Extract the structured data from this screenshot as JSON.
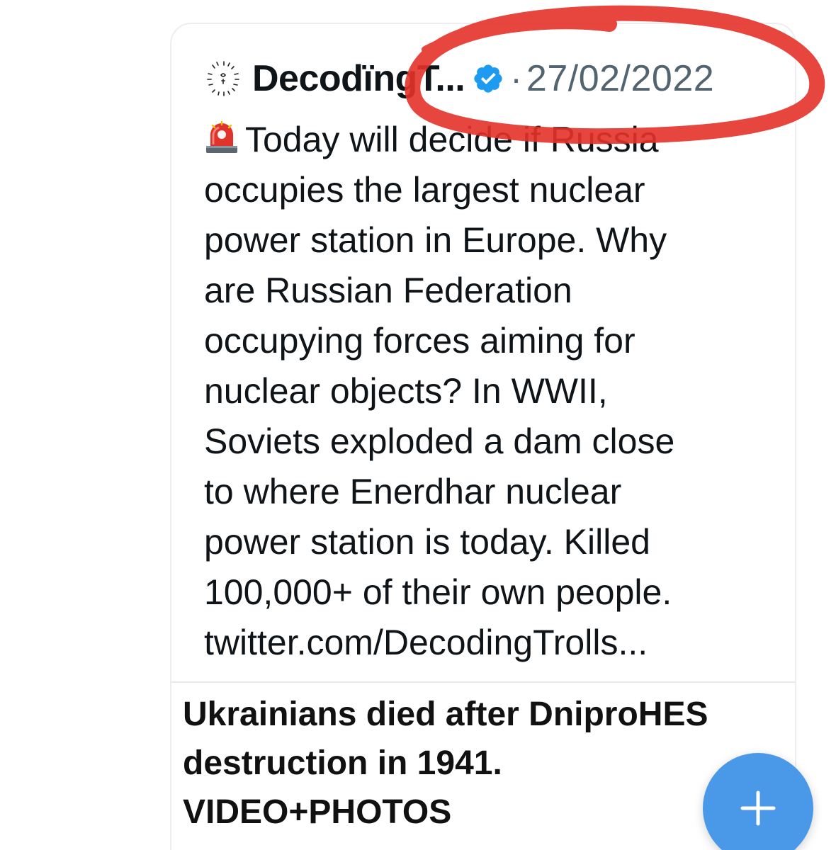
{
  "quoted_tweet": {
    "author_name": "DecodïngT...",
    "avatar_icon": "avatar-icon",
    "verified_icon": "verified-badge-icon",
    "separator": "·",
    "date": "27/02/2022",
    "siren_icon": "siren-icon",
    "text_lines": [
      "Today will decide if Russia",
      "occupies the largest nuclear",
      "power station in Europe. Why",
      "are Russian Federation",
      "occupying forces aiming for",
      "nuclear objects? In WWII,",
      "Soviets exploded a dam close",
      "to where Enerdhar nuclear",
      "power station is today. Killed",
      "100,000+ of their own people.",
      "twitter.com/DecodingTrolls..."
    ]
  },
  "link_preview": {
    "title_lines": [
      "Ukrainians died after DniproHES",
      "destruction in 1941.",
      "VIDEO+PHOTOS"
    ]
  },
  "compose_button": {
    "icon": "plus-icon"
  },
  "colors": {
    "verified": "#1d9bf0",
    "fab": "#4a99e9",
    "annotation": "#e5332a",
    "secondary_text": "#536471"
  }
}
